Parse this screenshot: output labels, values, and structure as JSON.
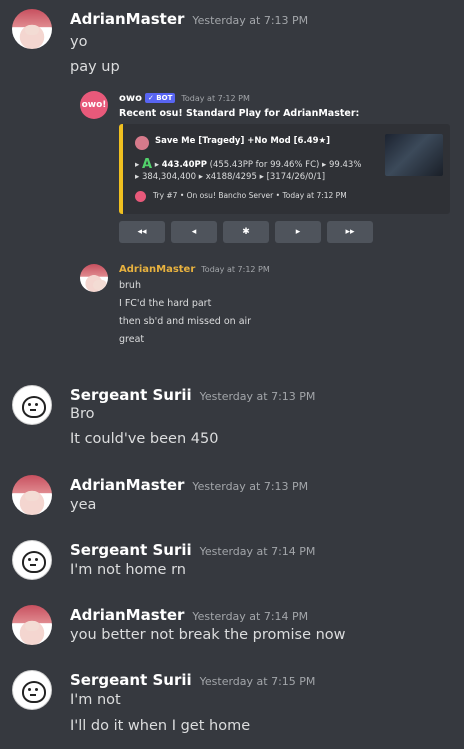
{
  "messages": {
    "m1": {
      "author": "AdrianMaster",
      "timestamp": "Yesterday at 7:13 PM",
      "lines": [
        "yo",
        "pay up"
      ]
    },
    "bot": {
      "avatar_text": "owo!",
      "author": "owo",
      "tag": "✓ BOT",
      "timestamp": "Today at 7:12 PM",
      "title": "Recent osu! Standard Play for AdrianMaster:",
      "embed": {
        "map": "Save Me [Tragedy] +No Mod [6.49★]",
        "rank": "A",
        "pp": "443.40PP",
        "pp_fc": "(455.43PP for 99.46% FC)",
        "accuracy": "99.43%",
        "score": "384,304,400",
        "combo": "x4188/4295",
        "hits": "[3174/26/0/1]",
        "footer": "Try #7 • On osu! Bancho Server • Today at 7:12 PM",
        "accent": "#f0c020"
      },
      "nav": [
        "◂◂",
        "◂",
        "✱",
        "▸",
        "▸▸"
      ]
    },
    "quote": {
      "author": "AdrianMaster",
      "timestamp": "Today at 7:12 PM",
      "lines": [
        "bruh",
        "I FC'd the hard part",
        "then sb'd and missed on air",
        "great"
      ]
    },
    "m2": {
      "author": "Sergeant Surii",
      "timestamp": "Yesterday at 7:13 PM",
      "lines": [
        "Bro",
        "It could've been 450"
      ]
    },
    "m3": {
      "author": "AdrianMaster",
      "timestamp": "Yesterday at 7:13 PM",
      "lines": [
        "yea"
      ]
    },
    "m4": {
      "author": "Sergeant Surii",
      "timestamp": "Yesterday at 7:14 PM",
      "lines": [
        "I'm not home rn"
      ]
    },
    "m5": {
      "author": "AdrianMaster",
      "timestamp": "Yesterday at 7:14 PM",
      "lines": [
        "you better not break the promise now"
      ]
    },
    "m6": {
      "author": "Sergeant Surii",
      "timestamp": "Yesterday at 7:15 PM",
      "lines": [
        "I'm not",
        "I'll do it when I get home"
      ]
    }
  }
}
